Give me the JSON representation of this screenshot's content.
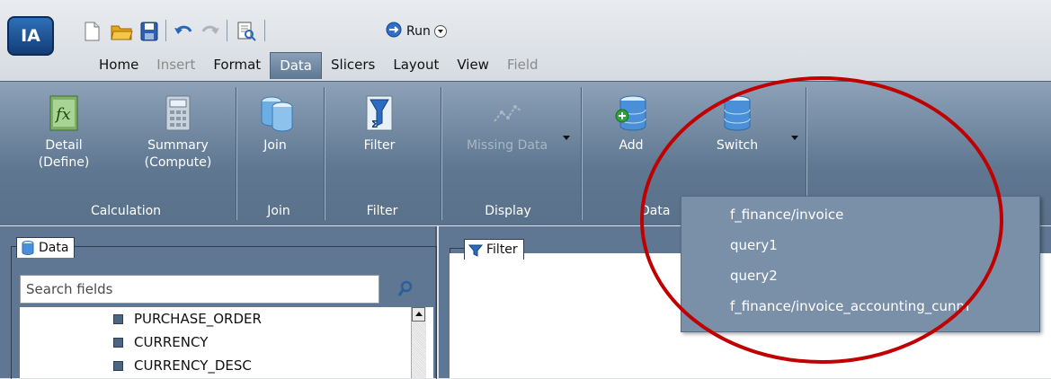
{
  "app": {
    "logo_text": "IA"
  },
  "quick_access": {
    "run_label": "Run"
  },
  "tabs": [
    {
      "label": "Home",
      "state": "normal"
    },
    {
      "label": "Insert",
      "state": "disabled"
    },
    {
      "label": "Format",
      "state": "normal"
    },
    {
      "label": "Data",
      "state": "active"
    },
    {
      "label": "Slicers",
      "state": "normal"
    },
    {
      "label": "Layout",
      "state": "normal"
    },
    {
      "label": "View",
      "state": "normal"
    },
    {
      "label": "Field",
      "state": "disabled"
    }
  ],
  "ribbon": {
    "buttons": {
      "detail": {
        "line1": "Detail",
        "line2": "(Define)",
        "icon": "fx-icon"
      },
      "summary": {
        "line1": "Summary",
        "line2": "(Compute)",
        "icon": "calculator-icon"
      },
      "join": {
        "line1": "Join",
        "icon": "join-icon"
      },
      "filter": {
        "line1": "Filter",
        "icon": "filter-funnel-icon"
      },
      "missing": {
        "line1": "Missing Data",
        "icon": "missing-data-icon",
        "disabled": true
      },
      "add": {
        "line1": "Add",
        "icon": "database-add-icon"
      },
      "switch": {
        "line1": "Switch",
        "icon": "database-icon"
      }
    },
    "groups": {
      "calculation": "Calculation",
      "join": "Join",
      "filter": "Filter",
      "display": "Display",
      "data": "Data"
    }
  },
  "data_pane": {
    "caption": "Data",
    "search_placeholder": "Search fields",
    "fields": [
      "PURCHASE_ORDER",
      "CURRENCY",
      "CURRENCY_DESC"
    ]
  },
  "filter_pane": {
    "caption": "Filter"
  },
  "switch_menu": {
    "items": [
      "f_finance/invoice",
      "query1",
      "query2",
      "f_finance/invoice_accounting_cunm"
    ]
  },
  "colors": {
    "ribbon": "#6a829c",
    "menu": "#7990a8",
    "annotation": "#c00000"
  }
}
